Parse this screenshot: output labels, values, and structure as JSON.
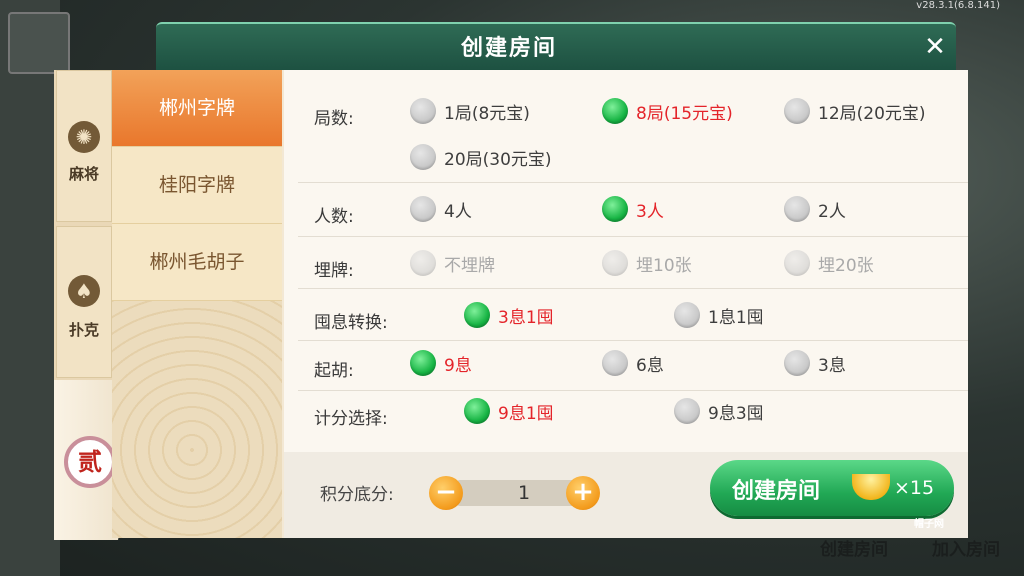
{
  "version": "v28.3.1(6.8.141)",
  "dialog": {
    "title": "创建房间",
    "close_glyph": "✕"
  },
  "categories": [
    {
      "label": "麻将",
      "icon": "mahjong-icon",
      "glyph": "✺"
    },
    {
      "label": "扑克",
      "icon": "spade-icon",
      "glyph": "♠"
    }
  ],
  "active_category": {
    "glyph": "贰",
    "icon": "zipai-icon"
  },
  "games": [
    {
      "label": "郴州字牌",
      "active": true
    },
    {
      "label": "桂阳字牌",
      "active": false
    },
    {
      "label": "郴州毛胡子",
      "active": false
    }
  ],
  "rows": {
    "rounds": {
      "label": "局数:",
      "options": [
        {
          "text": "1局(8元宝)",
          "selected": false
        },
        {
          "text": "8局(15元宝)",
          "selected": true
        },
        {
          "text": "12局(20元宝)",
          "selected": false
        },
        {
          "text": "20局(30元宝)",
          "selected": false
        }
      ]
    },
    "players": {
      "label": "人数:",
      "options": [
        {
          "text": "4人",
          "selected": false
        },
        {
          "text": "3人",
          "selected": true
        },
        {
          "text": "2人",
          "selected": false
        }
      ]
    },
    "bury": {
      "label": "埋牌:",
      "options": [
        {
          "text": "不埋牌",
          "selected": false,
          "disabled": true
        },
        {
          "text": "埋10张",
          "selected": false,
          "disabled": true
        },
        {
          "text": "埋20张",
          "selected": false,
          "disabled": true
        }
      ]
    },
    "convert": {
      "label": "囤息转换:",
      "options": [
        {
          "text": "3息1囤",
          "selected": true
        },
        {
          "text": "1息1囤",
          "selected": false
        }
      ]
    },
    "start": {
      "label": "起胡:",
      "options": [
        {
          "text": "9息",
          "selected": true
        },
        {
          "text": "6息",
          "selected": false
        },
        {
          "text": "3息",
          "selected": false
        }
      ]
    },
    "scoring": {
      "label": "计分选择:",
      "options": [
        {
          "text": "9息1囤",
          "selected": true
        },
        {
          "text": "9息3囤",
          "selected": false
        }
      ]
    }
  },
  "footer": {
    "score_label": "积分底分:",
    "score_value": "1",
    "minus_glyph": "−",
    "plus_glyph": "+",
    "create_label": "创建房间",
    "cost": "×15"
  },
  "background_menu": [
    "创建房间",
    "加入房间"
  ],
  "watermark": "帽子网",
  "colors": {
    "accent_green": "#21a855",
    "selected_text": "#e4242a",
    "header_green": "#1d5141",
    "active_tab_orange": "#e9772c"
  }
}
